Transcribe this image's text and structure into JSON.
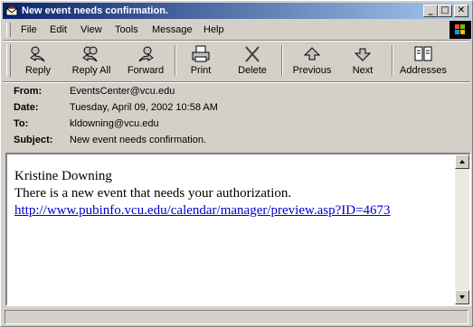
{
  "window": {
    "title": "New event needs confirmation."
  },
  "title_buttons": {
    "minimize": "_",
    "maximize": "□",
    "close": "✕"
  },
  "menu": {
    "items": [
      {
        "label": "File"
      },
      {
        "label": "Edit"
      },
      {
        "label": "View"
      },
      {
        "label": "Tools"
      },
      {
        "label": "Message"
      },
      {
        "label": "Help"
      }
    ]
  },
  "toolbar": {
    "buttons": [
      {
        "label": "Reply",
        "icon": "reply-icon"
      },
      {
        "label": "Reply All",
        "icon": "reply-all-icon"
      },
      {
        "label": "Forward",
        "icon": "forward-icon"
      },
      {
        "label": "Print",
        "icon": "print-icon"
      },
      {
        "label": "Delete",
        "icon": "delete-icon"
      },
      {
        "label": "Previous",
        "icon": "previous-icon"
      },
      {
        "label": "Next",
        "icon": "next-icon"
      },
      {
        "label": "Addresses",
        "icon": "addresses-icon"
      }
    ]
  },
  "headers": [
    {
      "label": "From:",
      "value": "EventsCenter@vcu.edu"
    },
    {
      "label": "Date:",
      "value": "Tuesday, April 09, 2002 10:58 AM"
    },
    {
      "label": "To:",
      "value": "kldowning@vcu.edu"
    },
    {
      "label": "Subject:",
      "value": "New event needs confirmation."
    }
  ],
  "message": {
    "line1": "Kristine Downing",
    "line2": "There is a new event that needs your authorization.",
    "link": "http://www.pubinfo.vcu.edu/calendar/manager/preview.asp?ID=4673"
  },
  "colors": {
    "title_start": "#0a246a",
    "title_end": "#a6caf0",
    "link": "#0000cc",
    "chrome": "#d4d0c8"
  }
}
